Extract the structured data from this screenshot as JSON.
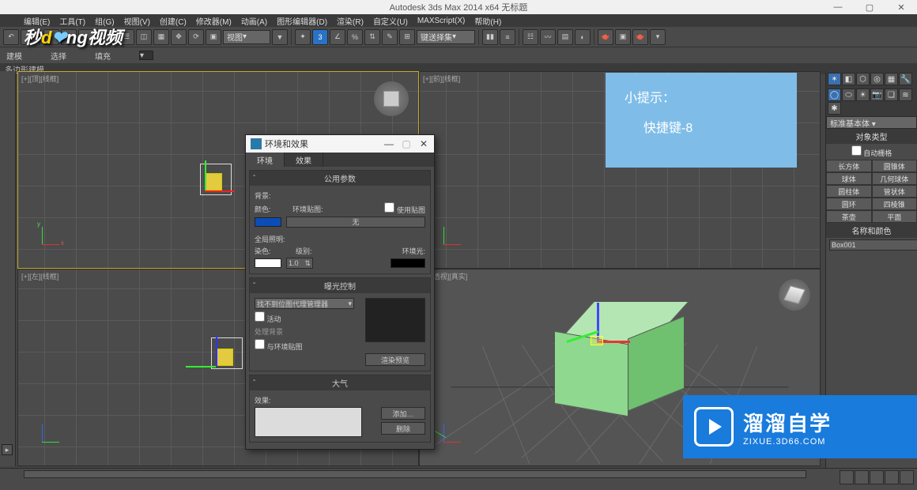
{
  "app": {
    "title": "Autodesk 3ds Max  2014 x64   无标题"
  },
  "menu": [
    "编辑(E)",
    "工具(T)",
    "组(G)",
    "视图(V)",
    "创建(C)",
    "修改器(M)",
    "动画(A)",
    "图形编辑器(D)",
    "渲染(R)",
    "自定义(U)",
    "MAXScript(X)",
    "帮助(H)"
  ],
  "toolbar": {
    "combo1": "视图",
    "combo2": "键送择集",
    "num": "3"
  },
  "ribbon": {
    "modeling": "建模",
    "selection": "选择",
    "fill": "填充"
  },
  "status_line": "多边形建模",
  "viewports": {
    "top": "[+][顶][线框]",
    "front": "[+][前][线框]",
    "left": "[+][左][线框]",
    "persp": "[+][透视][真实]"
  },
  "dialog": {
    "title": "环境和效果",
    "tab_env": "环境",
    "tab_fx": "效果",
    "rollout_common": "公用参数",
    "bg_label": "背景:",
    "color_label": "颜色:",
    "envmap_label": "环境贴图:",
    "use_map": "使用贴图",
    "map_none": "无",
    "global_label": "全局照明:",
    "tint_label": "染色:",
    "level_label": "级别:",
    "level_value": "1.0",
    "ambient_label": "环境光:",
    "rollout_exposure": "曝光控制",
    "exposure_combo": "找不到位图代理管理器",
    "active": "活动",
    "process_bg": "处理背景",
    "with_envmap": "与环境贴图",
    "render_preview": "渲染预览",
    "rollout_atmo": "大气",
    "effects_label": "效果:",
    "add": "添加…",
    "delete": "删除"
  },
  "tip": {
    "title": "小提示：",
    "body": "快捷键-8"
  },
  "panel": {
    "dropdown": "标准基本体",
    "rollout_type": "对象类型",
    "autogrid": "自动栅格",
    "prims": [
      "长方体",
      "圆锥体",
      "球体",
      "几何球体",
      "圆柱体",
      "管状体",
      "圆环",
      "四棱锥",
      "茶壶",
      "平面"
    ],
    "rollout_namecolor": "名称和颜色",
    "obj_name": "Box001"
  },
  "watermark": {
    "big": "溜溜自学",
    "small": "ZIXUE.3D66.COM"
  },
  "logo": {
    "a": "秒",
    "b": "d",
    "c": "ng",
    "d": "视频"
  }
}
